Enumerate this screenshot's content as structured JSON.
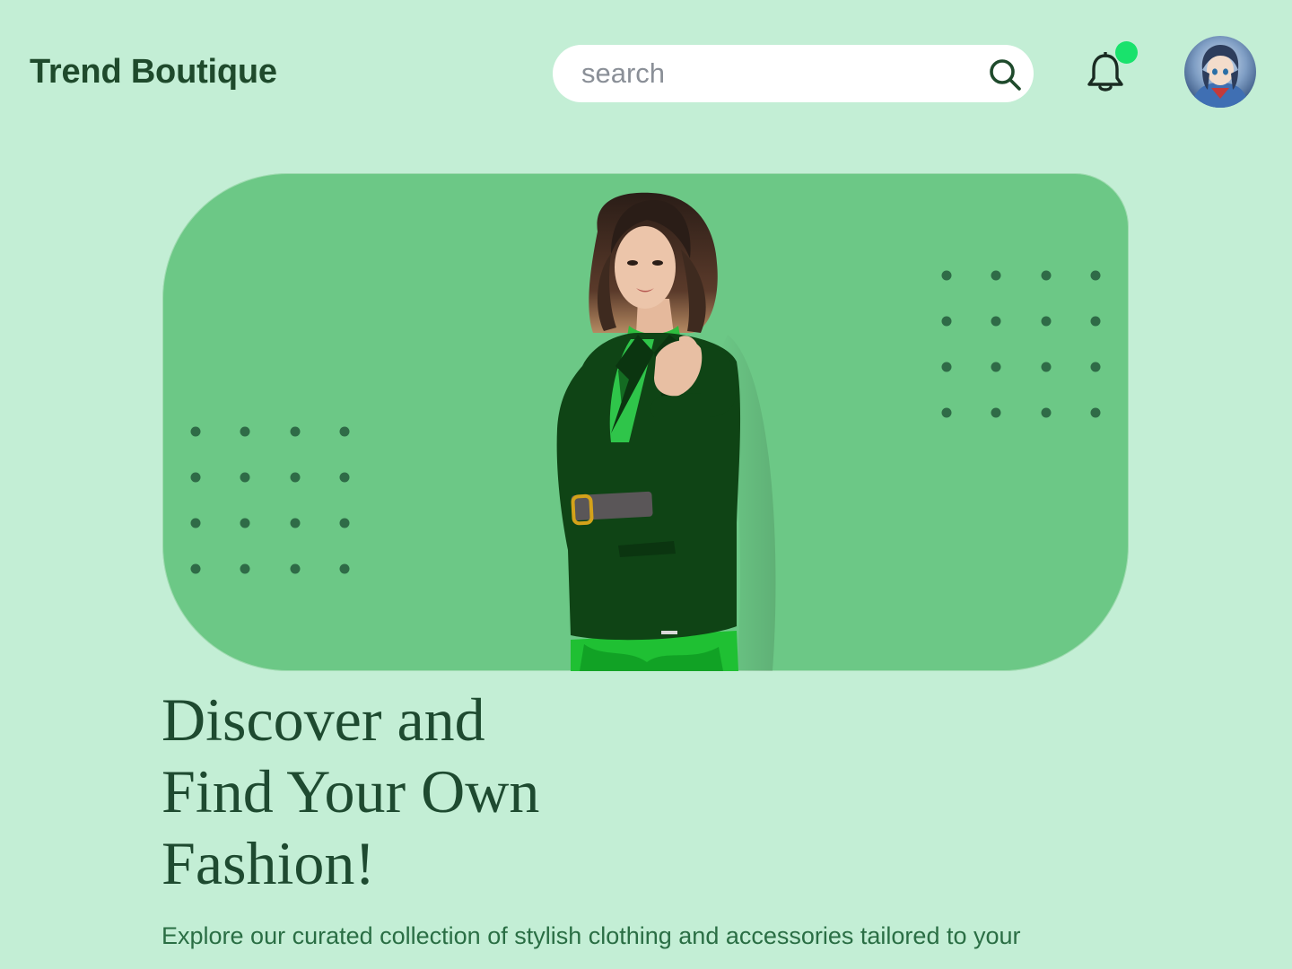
{
  "header": {
    "brand": "Trend Boutique",
    "search": {
      "placeholder": "search"
    },
    "icons": {
      "search": "search-icon",
      "notifications": "bell-icon",
      "notification_indicator": "notification-dot",
      "user": "avatar"
    },
    "has_unread_notifications": true
  },
  "hero": {
    "image": "model-in-green-blazer",
    "decoration": "dot-grid"
  },
  "content": {
    "headline_lines": [
      "Discover and",
      "Find Your Own",
      "Fashion!"
    ],
    "subtitle": "Explore our curated collection of stylish clothing and accessories tailored to your"
  },
  "colors": {
    "page_background": "#c3eed5",
    "hero_background": "#6cc886",
    "brand_text": "#1f4a2c",
    "headline_text": "#1e4a30",
    "subtitle_text": "#2a6e44",
    "notification_dot": "#19e26c",
    "dot_grid": "#2f6b47"
  }
}
